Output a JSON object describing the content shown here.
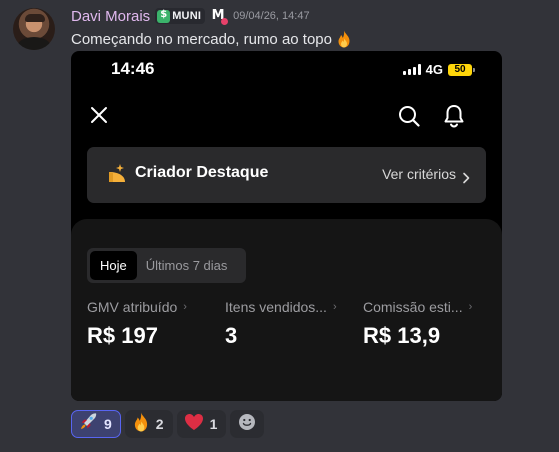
{
  "message": {
    "username": "Davi Morais",
    "role_badge": "MUNI",
    "server_tag": "M",
    "timestamp": "09/04/26, 14:47",
    "text": "Começando no mercado, rumo ao topo",
    "text_emoji": "fire"
  },
  "screenshot": {
    "status_bar": {
      "time": "14:46",
      "network": "4G",
      "battery": "50"
    },
    "icons": [
      "close-icon",
      "search-icon",
      "bell-icon"
    ],
    "creator_banner": {
      "title": "Criador Destaque",
      "link": "Ver critérios"
    },
    "period_tabs": [
      {
        "label": "Hoje",
        "active": true
      },
      {
        "label": "Últimos 7 dias",
        "active": false
      }
    ],
    "metrics": [
      {
        "label": "GMV atribuído",
        "value": "R$ 197"
      },
      {
        "label": "Itens vendidos...",
        "value": "3"
      },
      {
        "label": "Comissão esti...",
        "value": "R$ 13,9"
      }
    ]
  },
  "reactions": [
    {
      "emoji": "rocket",
      "count": "9",
      "selected": true
    },
    {
      "emoji": "fire",
      "count": "2",
      "selected": false
    },
    {
      "emoji": "red-heart",
      "count": "1",
      "selected": false
    }
  ],
  "colors": {
    "background": "#323339",
    "username": "#e0b8ee",
    "selected_reaction_border": "#5865f2",
    "battery": "#ffd60a"
  }
}
